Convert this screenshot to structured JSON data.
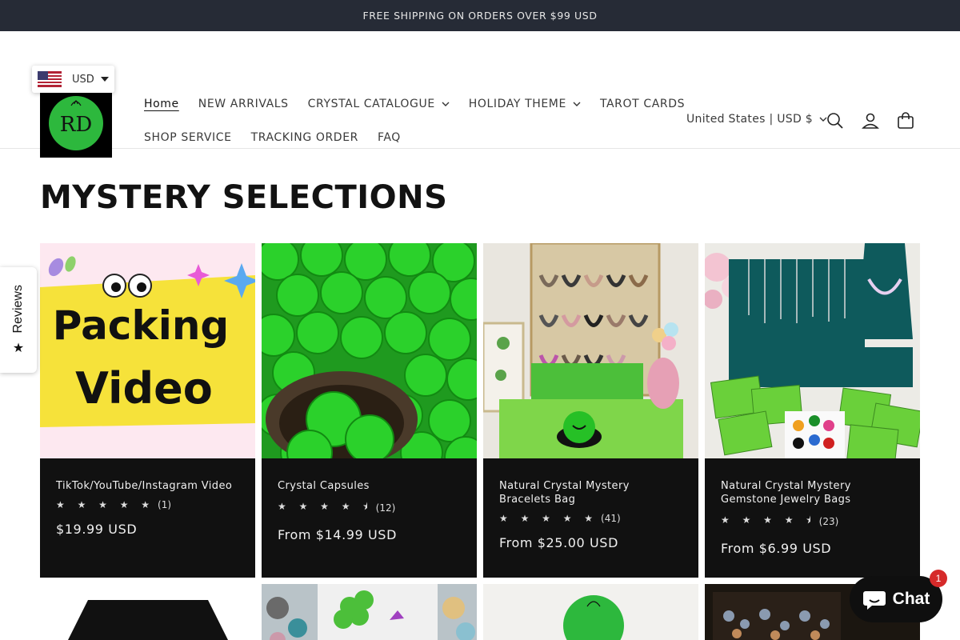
{
  "announcement": {
    "text": "FREE SHIPPING ON ORDERS OVER $99 USD"
  },
  "currency_widget": {
    "code": "USD",
    "flag": "us-flag-icon"
  },
  "logo": {
    "text": "RD"
  },
  "nav": {
    "row1": [
      {
        "label": "Home",
        "active": true,
        "dropdown": false
      },
      {
        "label": "NEW ARRIVALS",
        "active": false,
        "dropdown": false
      },
      {
        "label": "CRYSTAL CATALOGUE",
        "active": false,
        "dropdown": true
      },
      {
        "label": "HOLIDAY THEME",
        "active": false,
        "dropdown": true
      },
      {
        "label": "TAROT CARDS",
        "active": false,
        "dropdown": false
      }
    ],
    "row2": [
      {
        "label": "SHOP SERVICE"
      },
      {
        "label": "TRACKING ORDER"
      },
      {
        "label": "FAQ"
      }
    ]
  },
  "header_right": {
    "country_selector": "United States | USD $",
    "icons": [
      "search-icon",
      "account-icon",
      "cart-icon"
    ]
  },
  "section": {
    "title": "MYSTERY SELECTIONS"
  },
  "products": [
    {
      "title": "TikTok/YouTube/Instagram Video",
      "rating": 5,
      "stars": "★ ★ ★ ★ ★",
      "reviews": "(1)",
      "price": "$19.99 USD",
      "image_text_1": "Packing",
      "image_text_2": "Video"
    },
    {
      "title": "Crystal Capsules",
      "rating": 4.5,
      "stars": "★ ★ ★ ★ ⯨",
      "reviews": "(12)",
      "price": "From $14.99 USD"
    },
    {
      "title": "Natural Crystal Mystery Bracelets Bag",
      "rating": 5,
      "stars": "★ ★ ★ ★ ★",
      "reviews": "(41)",
      "price": "From $25.00 USD"
    },
    {
      "title": "Natural Crystal Mystery Gemstone Jewelry Bags",
      "rating": 4.5,
      "stars": "★ ★ ★ ★ ⯨",
      "reviews": "(23)",
      "price": "From $6.99 USD"
    }
  ],
  "reviews_tab": {
    "label": "Reviews"
  },
  "chat": {
    "label": "Chat",
    "badge": "1"
  },
  "colors": {
    "announcement_bg": "#262b36",
    "card_bg": "#111111",
    "chat_badge": "#d62a2a",
    "logo_green": "#2db83d"
  }
}
